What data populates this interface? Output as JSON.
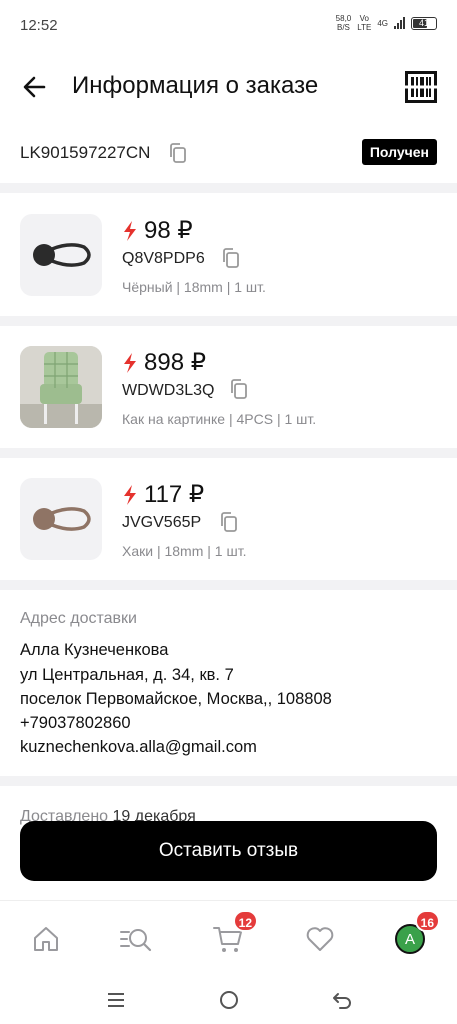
{
  "status_bar": {
    "time": "12:52",
    "net_speed_value": "58,0",
    "net_speed_unit": "B/S",
    "net_type_top": "Vo",
    "net_type_bottom": "LTE",
    "network": "4G",
    "battery": "41"
  },
  "header": {
    "title": "Информация о заказе",
    "back_icon": "arrow-left-icon",
    "barcode_icon": "barcode-icon"
  },
  "order": {
    "id": "LK901597227CN",
    "status": "Получен"
  },
  "items": [
    {
      "price": "98 ₽",
      "sku": "Q8V8PDP6",
      "props": "Чёрный | 18mm | 1 шт.",
      "image": "black-elastic-button-loop",
      "color": "#2b2b2b"
    },
    {
      "price": "898 ₽",
      "sku": "WDWD3L3Q",
      "props": "Как на картинке | 4PCS | 1 шт.",
      "image": "green-checked-chair-cover",
      "color": "#a8c79a"
    },
    {
      "price": "117 ₽",
      "sku": "JVGV565P",
      "props": "Хаки | 18mm | 1 шт.",
      "image": "khaki-elastic-button-loop",
      "color": "#8f7465"
    }
  ],
  "address": {
    "label": "Адрес доставки",
    "name": "Алла Кузнеченкова",
    "street": "ул Центральная, д. 34, кв. 7",
    "city": "поселок Первомайское, Москва,, 108808",
    "phone": "+79037802860",
    "email": "kuznechenkova.alla@gmail.com"
  },
  "delivery": {
    "label": "Доставлено",
    "date": "19 декабря"
  },
  "cta": {
    "label": "Оставить отзыв"
  },
  "tabs": [
    {
      "name": "home",
      "icon": "home-icon",
      "badge": ""
    },
    {
      "name": "catalog",
      "icon": "catalog-search-icon",
      "badge": ""
    },
    {
      "name": "cart",
      "icon": "cart-icon",
      "badge": "12"
    },
    {
      "name": "favorites",
      "icon": "heart-icon",
      "badge": ""
    },
    {
      "name": "profile",
      "icon": "avatar",
      "avatar_letter": "A",
      "badge": "16"
    }
  ],
  "colors": {
    "accent": "#000000",
    "badge": "#e43b3b",
    "lightning": "#e5322d",
    "muted_text": "#8a8a8e",
    "divider": "#f2f2f4"
  }
}
